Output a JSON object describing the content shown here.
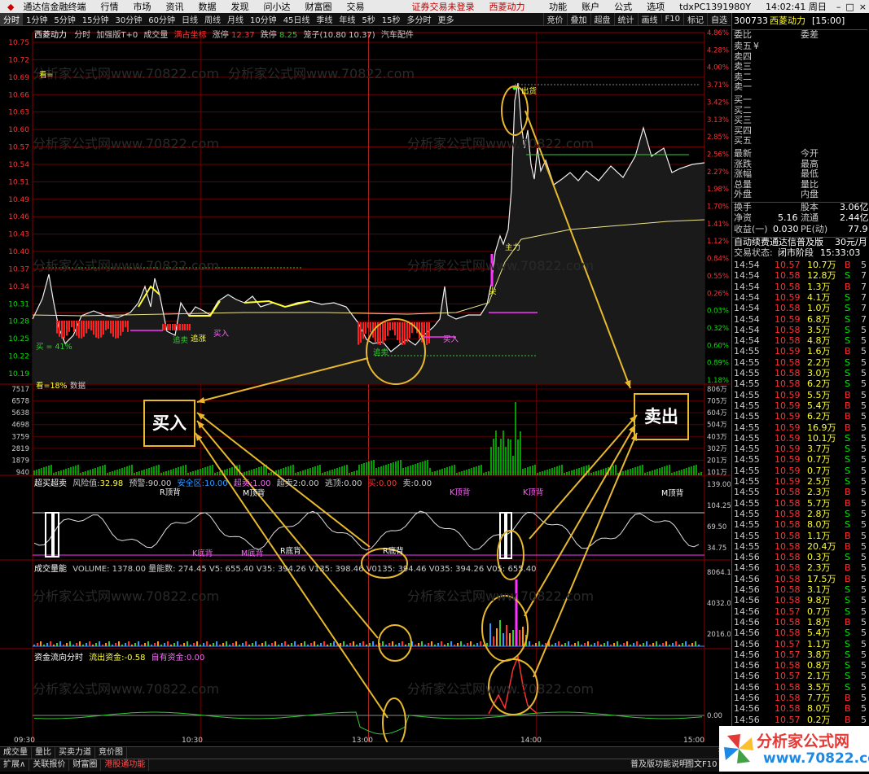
{
  "menubar": {
    "app_title": "通达信金融终端",
    "items": [
      "行情",
      "市场",
      "资讯",
      "数据",
      "发现",
      "问小达",
      "财富圈",
      "交易"
    ],
    "notice1": "证券交易未登录",
    "notice2": "西菱动力",
    "right_items": [
      "功能",
      "账户",
      "公式",
      "选项"
    ],
    "account": "tdxPC1391980Y",
    "clock": "14:02:41 周日"
  },
  "periodbar": {
    "periods": [
      "分时",
      "1分钟",
      "5分钟",
      "15分钟",
      "30分钟",
      "60分钟",
      "日线",
      "周线",
      "月线",
      "10分钟",
      "45日线",
      "季线",
      "年线",
      "5秒",
      "15秒",
      "多分时",
      "更多"
    ],
    "tools": [
      "竞价",
      "叠加",
      "超盘",
      "统计",
      "画线",
      "F10",
      "标记",
      "自选"
    ]
  },
  "main_info": {
    "name": "西菱动力",
    "indicator": "分时",
    "formula": "加强版T+0",
    "volume_lbl": "成交量",
    "signal": "满占坐标",
    "zt_label": "涨停",
    "zt_value": "12.37",
    "dt_label": "跌停",
    "dt_value": "8.25",
    "cage": "笼子(10.80 10.37)",
    "sector": "汽车配件"
  },
  "price_axis": [
    "10.75",
    "10.72",
    "10.69",
    "10.66",
    "10.63",
    "10.60",
    "10.57",
    "10.54",
    "10.51",
    "10.49",
    "10.46",
    "10.43",
    "10.40",
    "10.37",
    "10.34",
    "10.31",
    "10.28",
    "10.25",
    "10.22",
    "10.19"
  ],
  "pct_axis": [
    "4.86%",
    "4.28%",
    "4.00%",
    "3.71%",
    "3.42%",
    "3.13%",
    "2.85%",
    "2.56%",
    "2.27%",
    "1.98%",
    "1.70%",
    "1.41%",
    "1.12%",
    "0.84%",
    "0.55%",
    "0.26%",
    "0.03%",
    "0.32%",
    "0.60%",
    "0.89%",
    "1.18%"
  ],
  "vol_axis_left": [
    "7517",
    "6578",
    "5638",
    "4698",
    "3759",
    "2819",
    "1879",
    "940"
  ],
  "vol_axis_right": [
    "806万",
    "705万",
    "604万",
    "504万",
    "403万",
    "302万",
    "201万",
    "101万"
  ],
  "chart_labels": {
    "sell_label": "出货",
    "main_force": "主力",
    "buy1": "买入",
    "buy2": "买入",
    "buy3": "买入",
    "chase": "追卖",
    "chase2": "追卖",
    "bull": "追涨",
    "eq1": "看=",
    "buy_pct": "买 = 41%",
    "pct18": "看=18%",
    "data_lbl": "数据",
    "jian": "尖"
  },
  "annotations": {
    "buy_box": "买入",
    "sell_box": "卖出"
  },
  "ind1": {
    "title": "超买超卖",
    "risk_lbl": "风险值:",
    "risk_val": "32.98",
    "warn_lbl": "预警:",
    "warn_val": "90.00",
    "safe_lbl": "安全区:",
    "safe_val": "10.00",
    "chao_lbl": "超卖:",
    "chao_val": "1.00",
    "chao2_lbl": "超卖2:",
    "chao2_val": "0.00",
    "tou_lbl": "逃顶:",
    "tou_val": "0.00",
    "buy_lbl": "买:",
    "buy_val": "0.00",
    "sell_lbl": "卖:",
    "sell_val": "0.00",
    "axis": [
      "139.00",
      "104.25",
      "69.50",
      "34.75"
    ],
    "tags": [
      "R顶背",
      "M顶背",
      "K顶背",
      "K顶背",
      "M顶背",
      "K底背",
      "M底背",
      "R底背",
      "R底背",
      "R底背"
    ]
  },
  "ind2": {
    "title": "成交量能",
    "text": "VOLUME: 1378.00  量能数: 274.45  V5: 655.40  V35: 394.26  V135: 398.46  V0135: 394.46  V035: 394.26  V05: 655.40",
    "axis": [
      "8064.12",
      "4032.06",
      "2016.03"
    ]
  },
  "ind3": {
    "title": "资金流向分时",
    "outflow_lbl": "流出资金:",
    "outflow_val": "-0.58",
    "inflow_lbl": "自有资金:",
    "inflow_val": "0.00",
    "axis": [
      "0.00"
    ]
  },
  "time_axis": [
    "09:30",
    "10:30",
    "13:00",
    "14:00",
    "15:00"
  ],
  "bottombar": {
    "tabs1": [
      "成交量",
      "量比",
      "买卖力道",
      "竞价图"
    ],
    "tabs2": [
      "扩展∧",
      "关联报价",
      "财富圈",
      "港股通功能"
    ],
    "status_right": "普及版功能说明",
    "status_right2": "图文F10",
    "status_right3": "指"
  },
  "quote": {
    "code": "300733",
    "name": "西菱动力",
    "time": "[15:00]",
    "weibi_lbl": "委比",
    "weicha_lbl": "委差",
    "asks": [
      "卖五",
      "卖四",
      "卖三",
      "卖二",
      "卖一"
    ],
    "ask_yen": "¥",
    "bids": [
      "买一",
      "买二",
      "买三",
      "买四",
      "买五"
    ],
    "stats": [
      [
        "最新",
        "今开"
      ],
      [
        "涨跌",
        "最高"
      ],
      [
        "涨幅",
        "最低"
      ],
      [
        "总量",
        "量比"
      ],
      [
        "外盘",
        "内盘"
      ]
    ],
    "huanshou_lbl": "换手",
    "guben_lbl": "股本",
    "guben_val": "3.06亿",
    "jingzi_lbl": "净资",
    "jingzi_val": "5.16",
    "liutong_lbl": "流通",
    "liutong_val": "2.44亿",
    "shouyi_lbl": "收益(一)",
    "shouyi_val": "0.030",
    "pe_lbl": "PE(动)",
    "pe_val": "77.9",
    "promo": "自动续费通达信普及版",
    "promo_price": "30元/月",
    "trade_status_lbl": "交易状态:",
    "trade_status_val": "闭市阶段",
    "trade_time": "15:33:03",
    "ticks": [
      [
        "14:54",
        "10.57",
        "10.7万",
        "B",
        "5"
      ],
      [
        "14:54",
        "10.58",
        "12.8万",
        "S",
        "7"
      ],
      [
        "14:54",
        "10.58",
        "1.3万",
        "B",
        "7"
      ],
      [
        "14:54",
        "10.59",
        "4.1万",
        "S",
        "7"
      ],
      [
        "14:54",
        "10.58",
        "1.0万",
        "S",
        "7"
      ],
      [
        "14:54",
        "10.59",
        "6.8万",
        "S",
        "7"
      ],
      [
        "14:54",
        "10.58",
        "3.5万",
        "S",
        "5"
      ],
      [
        "14:54",
        "10.58",
        "4.8万",
        "S",
        "5"
      ],
      [
        "14:55",
        "10.59",
        "1.6万",
        "B",
        "5"
      ],
      [
        "14:55",
        "10.58",
        "2.2万",
        "S",
        "5"
      ],
      [
        "14:55",
        "10.58",
        "3.0万",
        "S",
        "5"
      ],
      [
        "14:55",
        "10.58",
        "6.2万",
        "S",
        "5"
      ],
      [
        "14:55",
        "10.59",
        "5.5万",
        "B",
        "5"
      ],
      [
        "14:55",
        "10.59",
        "5.4万",
        "B",
        "5"
      ],
      [
        "14:55",
        "10.59",
        "6.2万",
        "B",
        "5"
      ],
      [
        "14:55",
        "10.59",
        "16.9万",
        "B",
        "5"
      ],
      [
        "14:55",
        "10.59",
        "10.1万",
        "S",
        "5"
      ],
      [
        "14:55",
        "10.59",
        "3.7万",
        "S",
        "5"
      ],
      [
        "14:55",
        "10.59",
        "0.7万",
        "S",
        "5"
      ],
      [
        "14:55",
        "10.59",
        "0.7万",
        "S",
        "5"
      ],
      [
        "14:55",
        "10.59",
        "2.5万",
        "S",
        "5"
      ],
      [
        "14:55",
        "10.58",
        "2.3万",
        "B",
        "5"
      ],
      [
        "14:55",
        "10.58",
        "5.7万",
        "B",
        "5"
      ],
      [
        "14:55",
        "10.58",
        "2.8万",
        "S",
        "5"
      ],
      [
        "14:55",
        "10.58",
        "8.0万",
        "S",
        "5"
      ],
      [
        "14:55",
        "10.58",
        "1.1万",
        "B",
        "5"
      ],
      [
        "14:55",
        "10.58",
        "20.4万",
        "B",
        "5"
      ],
      [
        "14:56",
        "10.58",
        "0.3万",
        "S",
        "5"
      ],
      [
        "14:56",
        "10.58",
        "2.3万",
        "B",
        "5"
      ],
      [
        "14:56",
        "10.58",
        "17.5万",
        "B",
        "5"
      ],
      [
        "14:56",
        "10.58",
        "3.1万",
        "S",
        "5"
      ],
      [
        "14:56",
        "10.58",
        "9.8万",
        "S",
        "5"
      ],
      [
        "14:56",
        "10.57",
        "0.7万",
        "S",
        "5"
      ],
      [
        "14:56",
        "10.58",
        "1.8万",
        "B",
        "5"
      ],
      [
        "14:56",
        "10.58",
        "5.4万",
        "S",
        "5"
      ],
      [
        "14:56",
        "10.57",
        "1.1万",
        "S",
        "5"
      ],
      [
        "14:56",
        "10.57",
        "3.8万",
        "S",
        "5"
      ],
      [
        "14:56",
        "10.58",
        "0.8万",
        "S",
        "5"
      ],
      [
        "14:56",
        "10.57",
        "2.1万",
        "S",
        "5"
      ],
      [
        "14:56",
        "10.58",
        "3.5万",
        "S",
        "5"
      ],
      [
        "14:56",
        "10.58",
        "7.7万",
        "B",
        "5"
      ],
      [
        "14:56",
        "10.58",
        "8.0万",
        "B",
        "5"
      ],
      [
        "14:56",
        "10.57",
        "0.2万",
        "B",
        "5"
      ],
      [
        "14:56",
        "10.57",
        "1.3万",
        "B",
        "5"
      ],
      [
        "14:56",
        "10.58",
        "1.5万",
        "S",
        "5"
      ]
    ]
  },
  "watermark": "分析家公式网www.70822.com",
  "logo": {
    "line1": "分析家公式网",
    "line2": "www.70822.com"
  },
  "colors": {
    "up": "#ff3232",
    "down": "#00e600",
    "accent": "#e8b92c",
    "bg": "#000000"
  }
}
